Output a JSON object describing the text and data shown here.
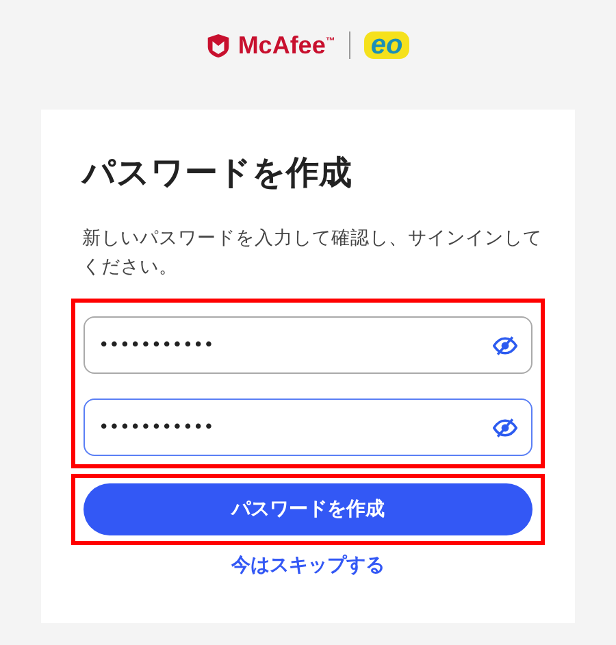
{
  "logo": {
    "brand": "McAfee",
    "trademark": "™",
    "partner": "eo"
  },
  "title": "パスワードを作成",
  "description": "新しいパスワードを入力して確認し、サインインしてください。",
  "field_group": {
    "highlighted": true
  },
  "fields": [
    {
      "value": "•••••••••••",
      "focused": false
    },
    {
      "value": "•••••••••••",
      "focused": true
    }
  ],
  "submit": {
    "label": "パスワードを作成",
    "highlighted": true
  },
  "skip_link": "今はスキップする"
}
